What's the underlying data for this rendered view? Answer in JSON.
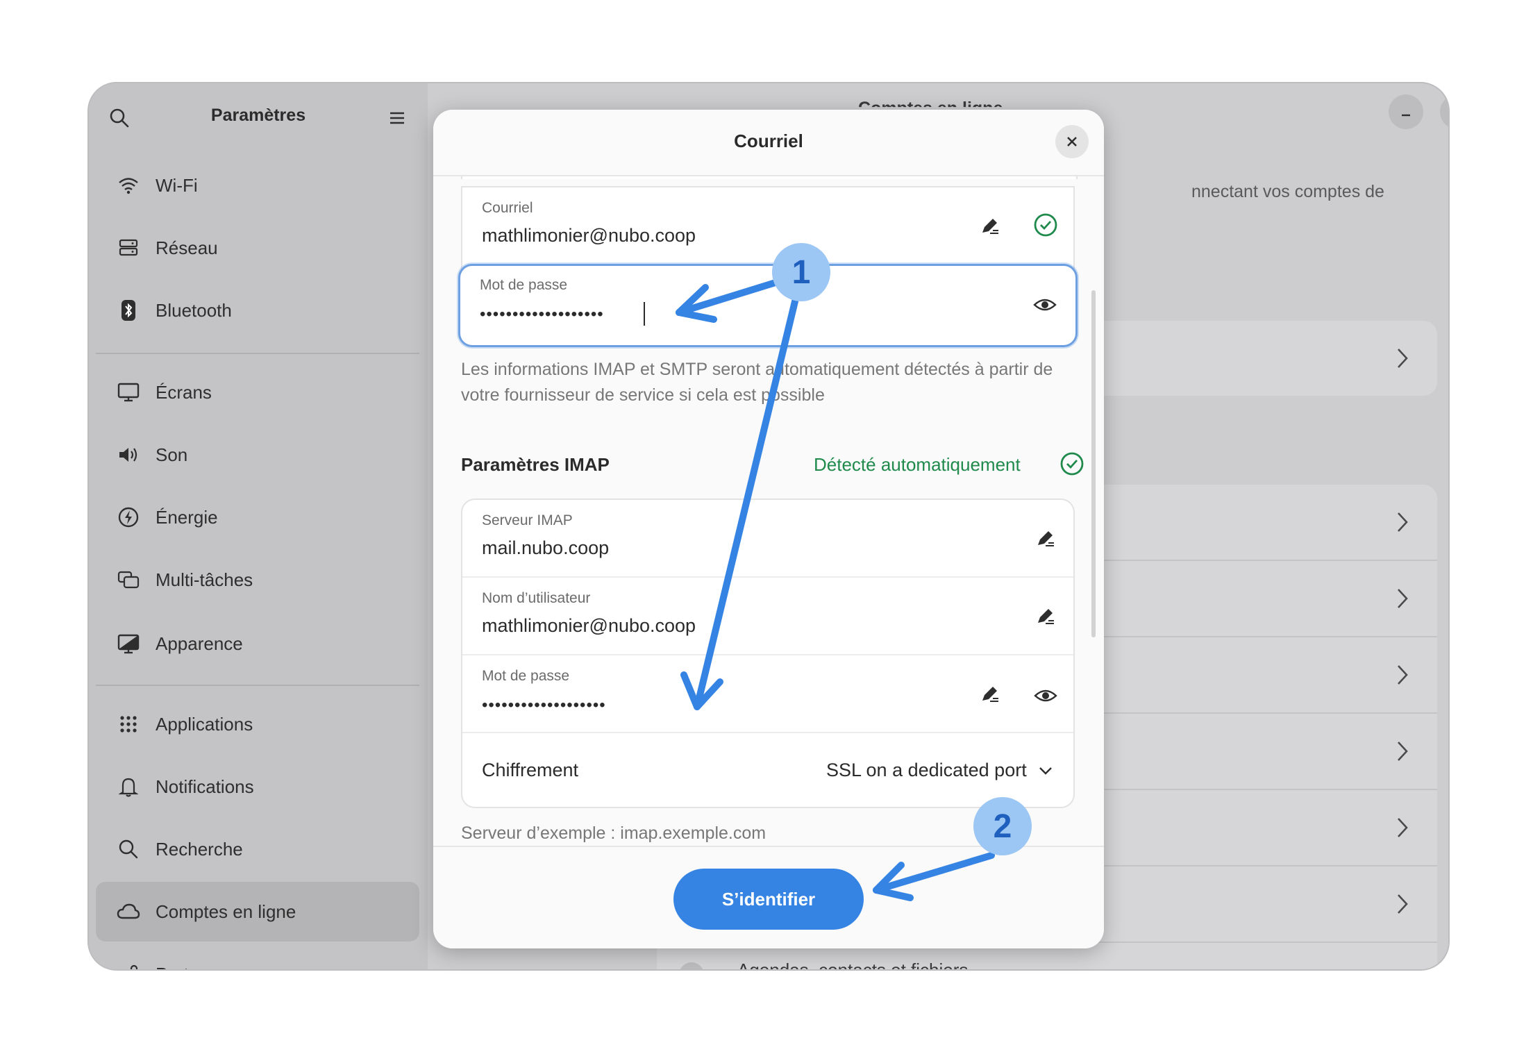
{
  "sidebar": {
    "title": "Paramètres",
    "items": [
      {
        "label": "Wi-Fi",
        "icon": "wifi-icon"
      },
      {
        "label": "Réseau",
        "icon": "network-icon"
      },
      {
        "label": "Bluetooth",
        "icon": "bluetooth-icon"
      },
      {
        "label": "Écrans",
        "icon": "display-icon"
      },
      {
        "label": "Son",
        "icon": "speaker-icon"
      },
      {
        "label": "Énergie",
        "icon": "power-icon"
      },
      {
        "label": "Multi-tâches",
        "icon": "multitasking-icon"
      },
      {
        "label": "Apparence",
        "icon": "appearance-icon"
      },
      {
        "label": "Applications",
        "icon": "apps-grid-icon"
      },
      {
        "label": "Notifications",
        "icon": "bell-icon"
      },
      {
        "label": "Recherche",
        "icon": "search-icon"
      },
      {
        "label": "Comptes en ligne",
        "icon": "cloud-icon",
        "active": true
      },
      {
        "label": "Partage",
        "icon": "share-icon"
      }
    ]
  },
  "content": {
    "title_partial": "Comptes en ligne",
    "intro_partial": "nnectant vos comptes de",
    "bottom_row_label": "Agendas, contacts et fichiers"
  },
  "dialog": {
    "title": "Courriel",
    "email_field": {
      "label": "Courriel",
      "value": "mathlimonier@nubo.coop"
    },
    "password_field": {
      "label": "Mot de passe",
      "value": "•••••••••••••••••••"
    },
    "hint": "Les informations IMAP et SMTP seront automatiquement détectés à partir de votre fournisseur de service si cela est possible",
    "imap": {
      "section_title": "Paramètres IMAP",
      "detected_label": "Détecté automatiquement",
      "server": {
        "label": "Serveur IMAP",
        "value": "mail.nubo.coop"
      },
      "username": {
        "label": "Nom d’utilisateur",
        "value": "mathlimonier@nubo.coop"
      },
      "password": {
        "label": "Mot de passe",
        "value": "•••••••••••••••••••"
      },
      "encryption": {
        "label": "Chiffrement",
        "value": "SSL on a dedicated port"
      },
      "example": "Serveur d’exemple : imap.exemple.com"
    },
    "signin_label": "S’identifier"
  },
  "annotations": {
    "badge1": "1",
    "badge2": "2",
    "color": "#3584e4"
  },
  "colors": {
    "accent": "#3584e4",
    "success": "#1f8a4c"
  }
}
